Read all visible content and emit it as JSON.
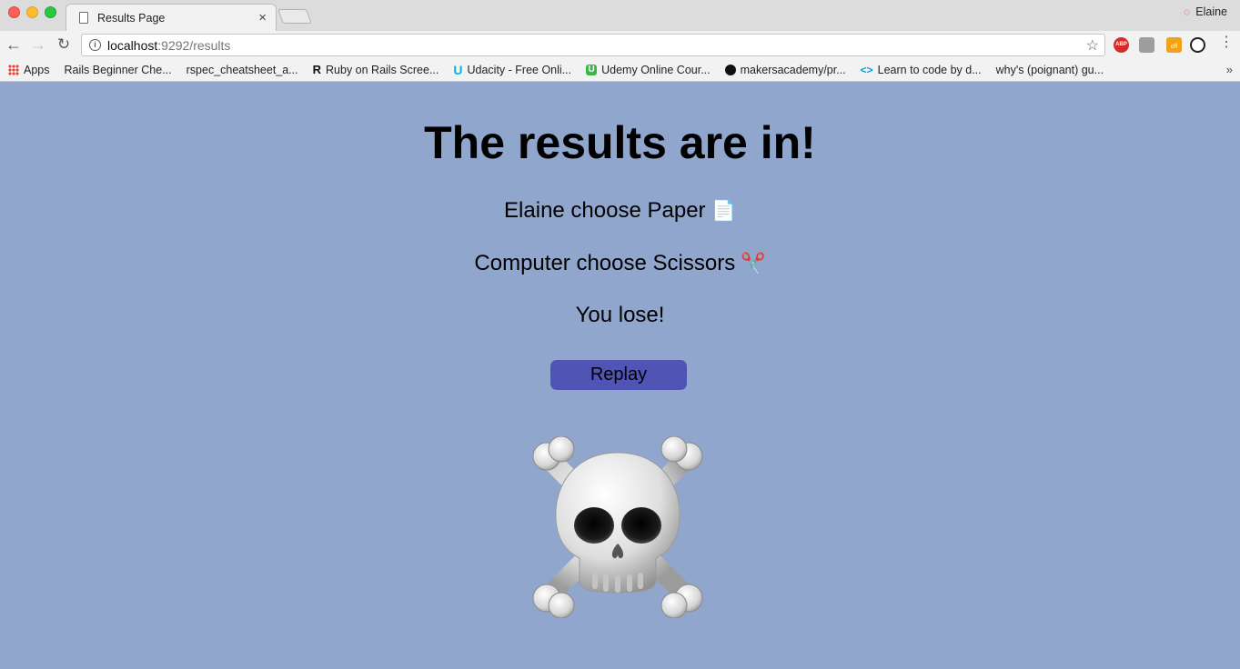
{
  "browser": {
    "tab_title": "Results Page",
    "tab_close": "×",
    "profile_name": "Elaine",
    "url_host": "localhost",
    "url_rest": ":9292/results",
    "menu_dots": "⋮",
    "bookmarks_more": "»",
    "bookmarks": [
      {
        "label": "Apps",
        "icon": "apps-grid-icon"
      },
      {
        "label": "Rails Beginner Che...",
        "icon": "page-icon"
      },
      {
        "label": "rspec_cheatsheet_a...",
        "icon": "page-icon"
      },
      {
        "label": "Ruby on Rails Scree...",
        "icon": "rails-icon"
      },
      {
        "label": "Udacity - Free Onli...",
        "icon": "udacity-icon"
      },
      {
        "label": "Udemy Online Cour...",
        "icon": "udemy-icon"
      },
      {
        "label": "makersacademy/pr...",
        "icon": "github-icon"
      },
      {
        "label": "Learn to code by d...",
        "icon": "code-icon"
      },
      {
        "label": "why's (poignant) gu...",
        "icon": "page-icon"
      }
    ],
    "extensions": {
      "abp": "ABP",
      "off": "off"
    }
  },
  "results": {
    "title": "The results are in!",
    "player_text": "Elaine choose Paper",
    "player_emoji": "📄",
    "computer_text": "Computer choose Scissors",
    "computer_emoji": "✂️",
    "outcome": "You lose!",
    "replay_label": "Replay"
  },
  "colors": {
    "page_background": "#91a6cd",
    "button_background": "#5054b4"
  }
}
